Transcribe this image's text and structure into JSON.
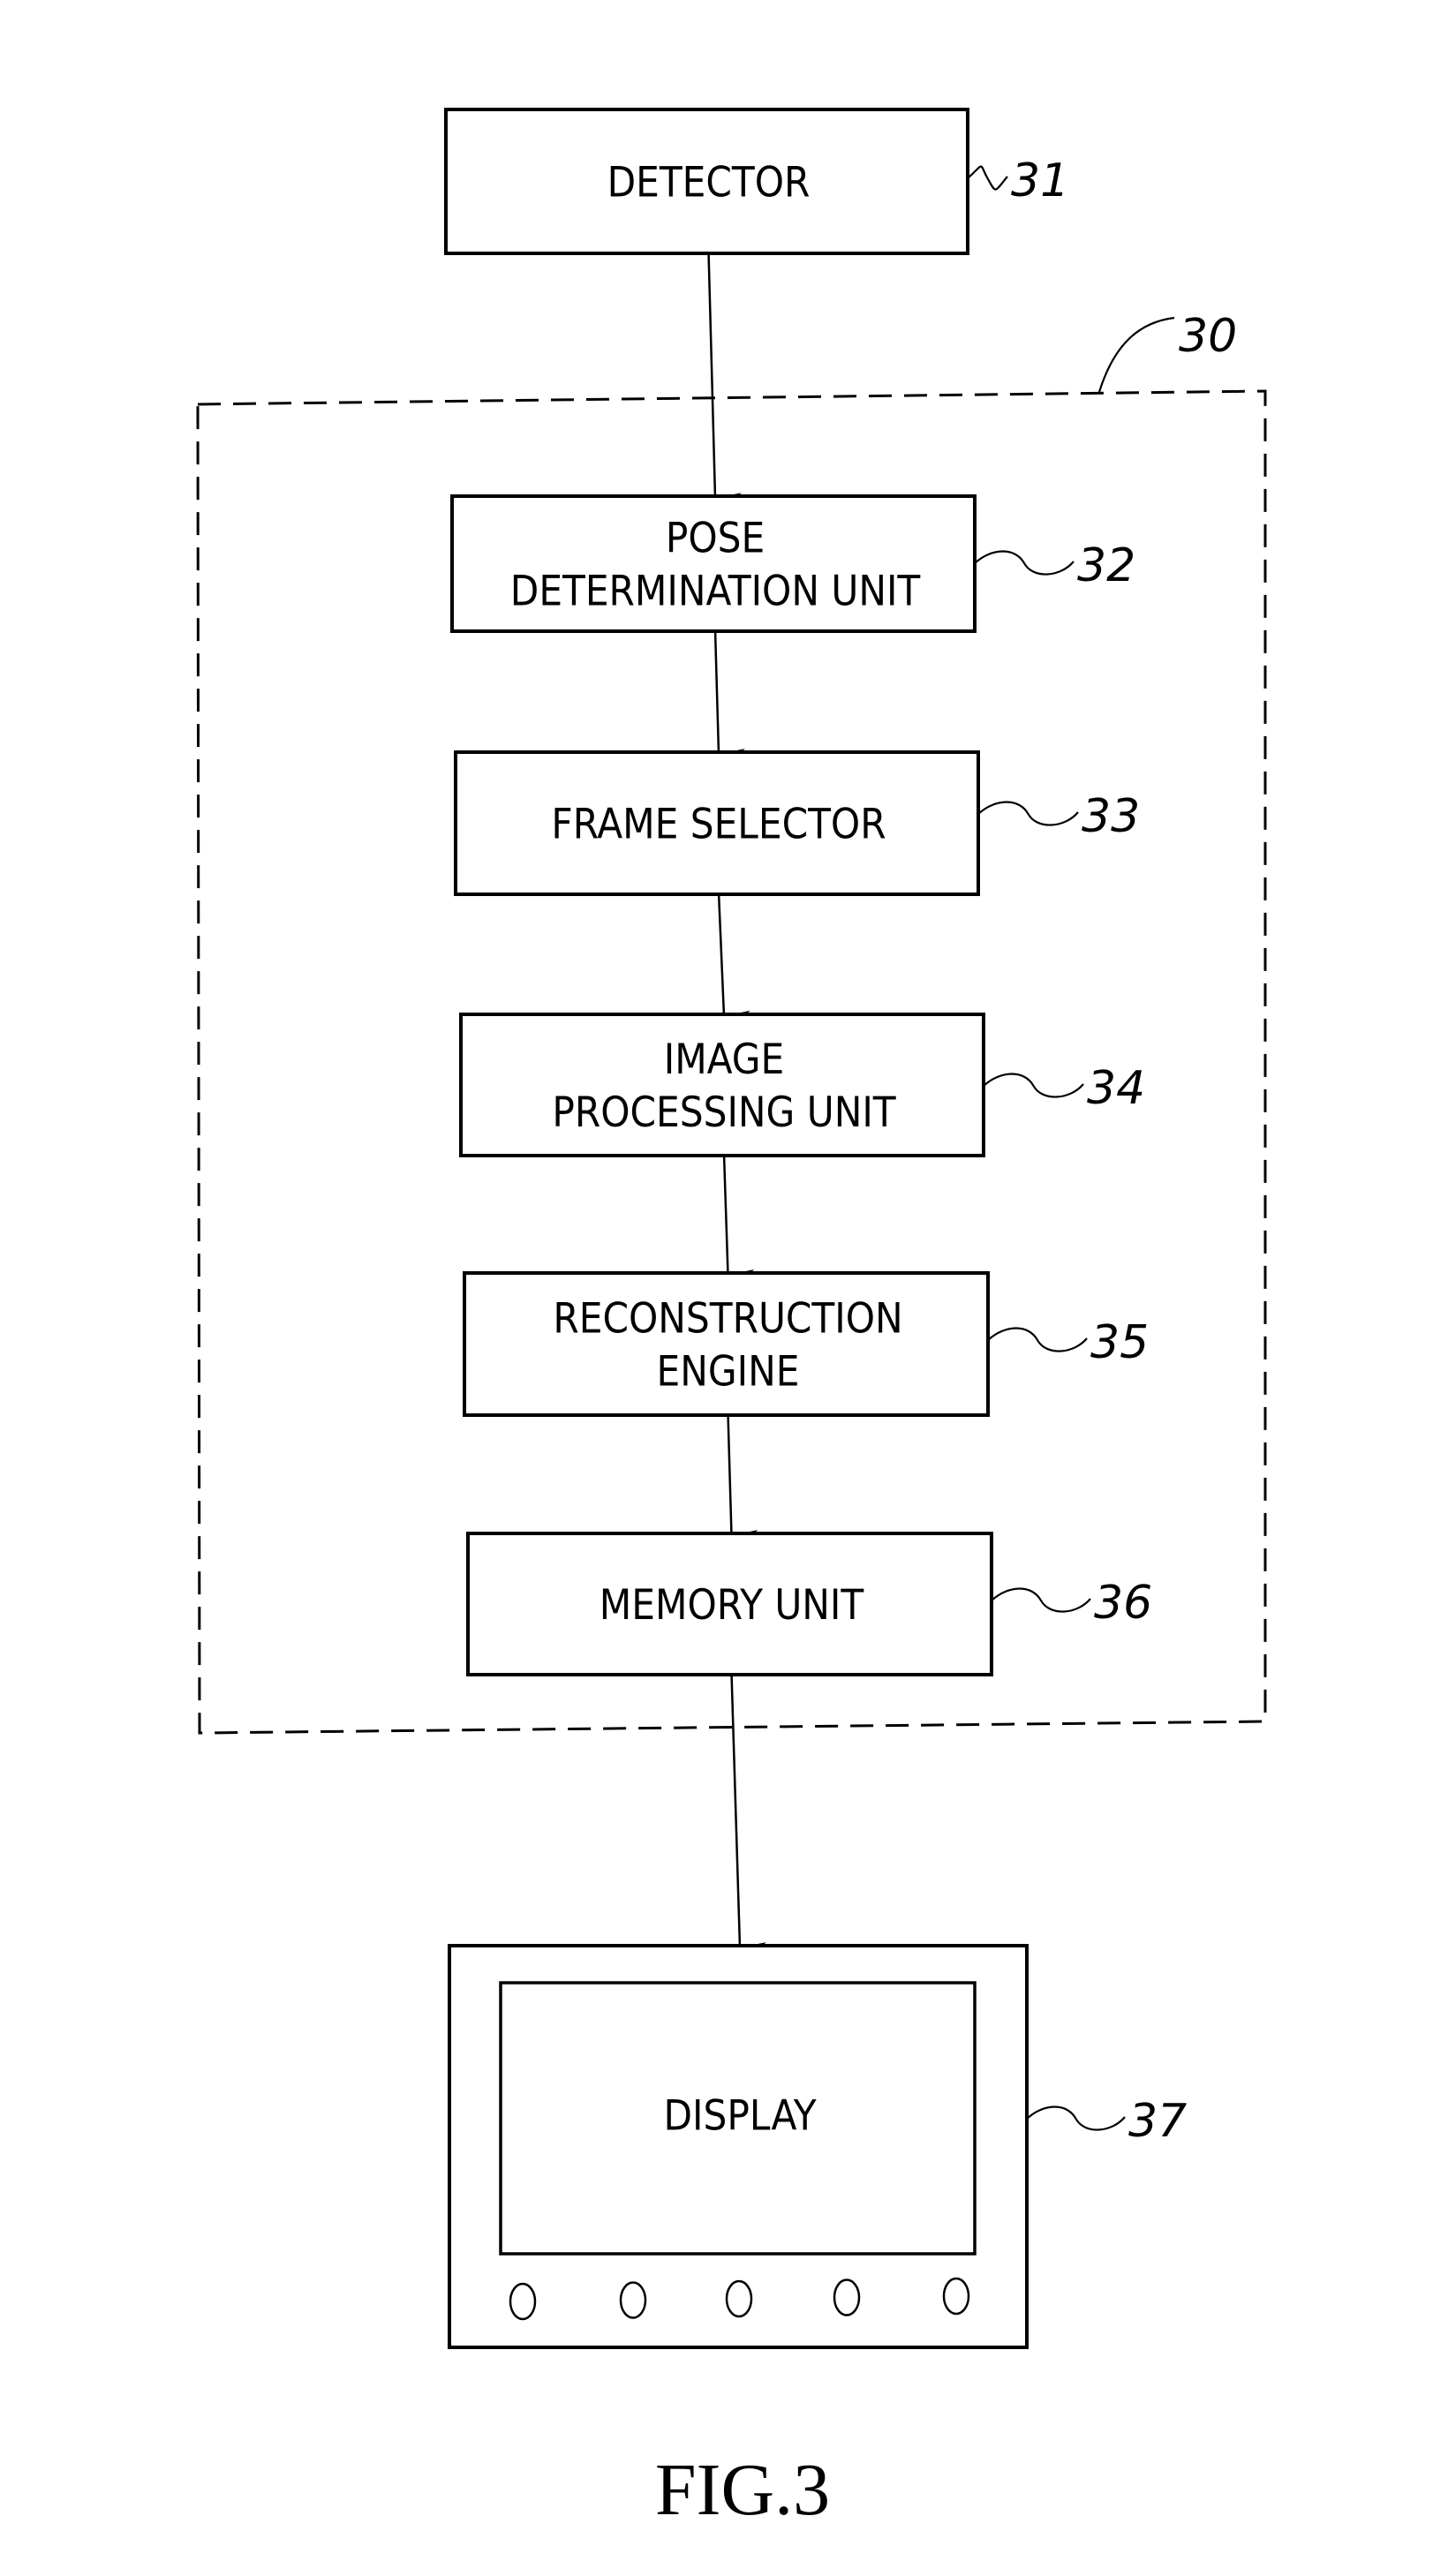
{
  "figure": {
    "caption": "FIG.3",
    "container": {
      "ref": "30",
      "style": "dashed"
    },
    "blocks": [
      {
        "id": "detector",
        "ref": "31",
        "lines": [
          "DETECTOR"
        ],
        "inside_container": false
      },
      {
        "id": "pose-determination-unit",
        "ref": "32",
        "lines": [
          "POSE",
          "DETERMINATION  UNIT"
        ],
        "inside_container": true
      },
      {
        "id": "frame-selector",
        "ref": "33",
        "lines": [
          "FRAME  SELECTOR"
        ],
        "inside_container": true
      },
      {
        "id": "image-processing-unit",
        "ref": "34",
        "lines": [
          "IMAGE",
          "PROCESSING  UNIT"
        ],
        "inside_container": true
      },
      {
        "id": "reconstruction-engine",
        "ref": "35",
        "lines": [
          "RECONSTRUCTION",
          "ENGINE"
        ],
        "inside_container": true
      },
      {
        "id": "memory-unit",
        "ref": "36",
        "lines": [
          "MEMORY  UNIT"
        ],
        "inside_container": true
      }
    ],
    "display": {
      "id": "display",
      "ref": "37",
      "lines": [
        "DISPLAY"
      ],
      "button_count": 5
    },
    "flow": [
      [
        "detector",
        "pose-determination-unit"
      ],
      [
        "pose-determination-unit",
        "frame-selector"
      ],
      [
        "frame-selector",
        "image-processing-unit"
      ],
      [
        "image-processing-unit",
        "reconstruction-engine"
      ],
      [
        "reconstruction-engine",
        "memory-unit"
      ],
      [
        "memory-unit",
        "display"
      ]
    ]
  }
}
